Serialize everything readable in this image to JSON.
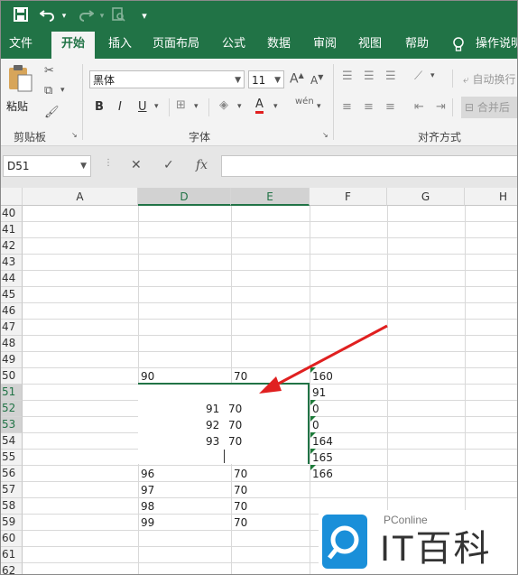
{
  "quick_access": {
    "save": "save-icon",
    "undo": "undo-icon",
    "redo": "redo-icon",
    "preview": "print-preview-icon",
    "customize": "customize-icon"
  },
  "tabs": [
    "文件",
    "开始",
    "插入",
    "页面布局",
    "公式",
    "数据",
    "审阅",
    "视图",
    "帮助",
    "操作说明"
  ],
  "ribbon": {
    "paste_label": "粘贴",
    "clipboard_label": "剪贴板",
    "font_name": "黑体",
    "font_size": "11",
    "font_group_label": "字体",
    "bold": "B",
    "italic": "I",
    "underline": "U",
    "font_color": "A",
    "wen": "wén",
    "wrap_text": "自动换行",
    "merge_center": "合并后",
    "align_group_label": "对齐方式"
  },
  "formula_bar": {
    "name_box": "D51",
    "cancel": "✕",
    "enter": "✓",
    "fx": "fx",
    "value": ""
  },
  "columns": [
    "A",
    "D",
    "E",
    "F",
    "G",
    "H"
  ],
  "rows": [
    "40",
    "41",
    "42",
    "43",
    "44",
    "45",
    "46",
    "47",
    "48",
    "49",
    "50",
    "51",
    "52",
    "53",
    "54",
    "55",
    "56",
    "57",
    "58",
    "59",
    "60",
    "61",
    "62"
  ],
  "cells": {
    "d50": "90",
    "e50": "70",
    "f50": "160",
    "f51": "91",
    "f52": "0",
    "f53": "0",
    "f54": "164",
    "f55": "165",
    "d56": "96",
    "e56": "70",
    "f56": "166",
    "d57": "97",
    "e57": "70",
    "d58": "98",
    "e58": "70",
    "d59": "99",
    "e59": "70"
  },
  "edit_lines": [
    {
      "a": "91",
      "b": "70"
    },
    {
      "a": "92",
      "b": "70"
    },
    {
      "a": "93",
      "b": "70"
    }
  ],
  "watermark": {
    "brand": "PConline",
    "name": "IT百科"
  },
  "colors": {
    "excel_green": "#217346",
    "arrow_red": "#e02020",
    "logo_blue": "#1a8fd9"
  }
}
